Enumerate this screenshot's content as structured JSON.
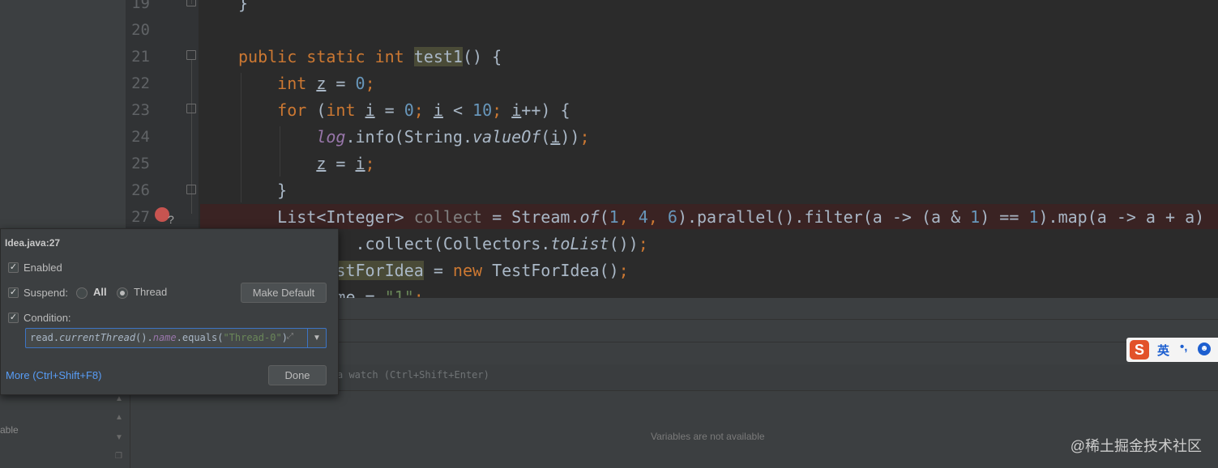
{
  "editor": {
    "line_numbers": [
      "19",
      "20",
      "21",
      "22",
      "23",
      "24",
      "25",
      "26",
      "27"
    ],
    "lines": [
      {
        "tokens": [
          {
            "t": "}"
          }
        ]
      },
      {
        "tokens": []
      },
      {
        "tokens": [
          {
            "t": "public static int ",
            "c": "kw"
          },
          {
            "t": "test1",
            "c": "hl"
          },
          {
            "t": "() {"
          }
        ]
      },
      {
        "tokens": [
          {
            "t": "    "
          },
          {
            "t": "int ",
            "c": "kw"
          },
          {
            "t": "z",
            "c": "ul"
          },
          {
            "t": " = "
          },
          {
            "t": "0",
            "c": "num"
          },
          {
            "t": ";",
            "c": "kw"
          }
        ]
      },
      {
        "tokens": [
          {
            "t": "    "
          },
          {
            "t": "for ",
            "c": "kw"
          },
          {
            "t": "("
          },
          {
            "t": "int ",
            "c": "kw"
          },
          {
            "t": "i",
            "c": "ul"
          },
          {
            "t": " = "
          },
          {
            "t": "0",
            "c": "num"
          },
          {
            "t": "; ",
            "c": "kw"
          },
          {
            "t": "i",
            "c": "ul"
          },
          {
            "t": " < "
          },
          {
            "t": "10",
            "c": "num"
          },
          {
            "t": "; ",
            "c": "kw"
          },
          {
            "t": "i",
            "c": "ul"
          },
          {
            "t": "++) {"
          }
        ]
      },
      {
        "tokens": [
          {
            "t": "        "
          },
          {
            "t": "log",
            "c": "field"
          },
          {
            "t": ".info(String."
          },
          {
            "t": "valueOf",
            "c": "ital"
          },
          {
            "t": "("
          },
          {
            "t": "i",
            "c": "ul"
          },
          {
            "t": "))"
          },
          {
            "t": ";",
            "c": "kw"
          }
        ]
      },
      {
        "tokens": [
          {
            "t": "        "
          },
          {
            "t": "z",
            "c": "ul"
          },
          {
            "t": " = "
          },
          {
            "t": "i",
            "c": "ul"
          },
          {
            "t": ";",
            "c": "kw"
          }
        ]
      },
      {
        "tokens": [
          {
            "t": "    }"
          }
        ]
      },
      {
        "tokens": [
          {
            "t": "    List<Integer> "
          },
          {
            "t": "collect",
            "c": "gray"
          },
          {
            "t": " = Stream."
          },
          {
            "t": "of",
            "c": "ital"
          },
          {
            "t": "("
          },
          {
            "t": "1",
            "c": "num"
          },
          {
            "t": ", ",
            "c": "kw"
          },
          {
            "t": "4",
            "c": "num"
          },
          {
            "t": ", ",
            "c": "kw"
          },
          {
            "t": "6",
            "c": "num"
          },
          {
            "t": ").parallel().filter(a -> (a & "
          },
          {
            "t": "1",
            "c": "num"
          },
          {
            "t": ") == "
          },
          {
            "t": "1",
            "c": "num"
          },
          {
            "t": ").map(a -> a + a)"
          }
        ]
      },
      {
        "tokens": [
          {
            "t": "            .collect(Collectors."
          },
          {
            "t": "toList",
            "c": "ital"
          },
          {
            "t": "())"
          },
          {
            "t": ";",
            "c": "kw"
          }
        ]
      },
      {
        "tokens": [
          {
            "t": "  rIdea "
          },
          {
            "t": "testForIdea",
            "c": "hl"
          },
          {
            "t": " = "
          },
          {
            "t": "new ",
            "c": "kw"
          },
          {
            "t": "TestForIdea()"
          },
          {
            "t": ";",
            "c": "kw"
          }
        ]
      },
      {
        "tokens": [
          {
            "t": "  rIdea.name = "
          },
          {
            "t": "\"1\"",
            "c": "str"
          },
          {
            "t": ";",
            "c": "kw"
          }
        ]
      }
    ],
    "breakpoint_marker": "?"
  },
  "popup": {
    "title": "Idea.java:27",
    "enabled_label": "Enabled",
    "suspend_label": "Suspend:",
    "all_label": "All",
    "thread_label": "Thread",
    "make_default_label": "Make Default",
    "condition_label": "Condition:",
    "condition_tokens": [
      {
        "t": "read."
      },
      {
        "t": "currentThread",
        "c": "ital"
      },
      {
        "t": "()."
      },
      {
        "t": "name",
        "c": "field"
      },
      {
        "t": ".equals("
      },
      {
        "t": "\"Thread-0\"",
        "c": "str"
      },
      {
        "t": ")"
      }
    ],
    "more_label": "More (Ctrl+Shift+F8)",
    "done_label": "Done"
  },
  "debug": {
    "watch_hint": "a watch (Ctrl+Shift+Enter)",
    "variables_message": "Variables are not available",
    "left_fragment": "able"
  },
  "ime": {
    "logo": "S",
    "lang": "英",
    "punct": "•,"
  },
  "watermark": "@稀土掘金技术社区",
  "colors": {
    "breakpoint": "#c75450",
    "accent_link": "#589df6",
    "focus_border": "#3d74c4"
  }
}
